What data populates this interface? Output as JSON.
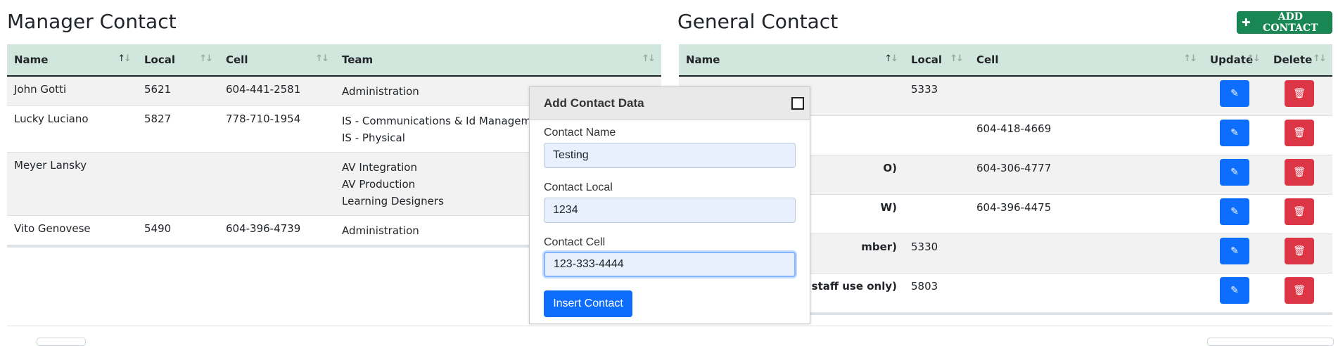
{
  "manager": {
    "title": "Manager Contact",
    "headers": {
      "name": "Name",
      "local": "Local",
      "cell": "Cell",
      "team": "Team"
    },
    "rows": [
      {
        "name": "John Gotti",
        "local": "5621",
        "cell": "604-441-2581",
        "team": [
          "Administration"
        ]
      },
      {
        "name": "Lucky Luciano",
        "local": "5827",
        "cell": "778-710-1954",
        "team": [
          "IS - Communications & Id Manageme",
          "IS - Physical"
        ]
      },
      {
        "name": "Meyer Lansky",
        "local": "",
        "cell": "",
        "team": [
          "AV Integration",
          "AV Production",
          "Learning Designers"
        ]
      },
      {
        "name": "Vito Genovese",
        "local": "5490",
        "cell": "604-396-4739",
        "team": [
          "Administration"
        ]
      }
    ]
  },
  "general": {
    "title": "General Contact",
    "add_button": "ADD CONTACT",
    "headers": {
      "name": "Name",
      "local": "Local",
      "cell": "Cell",
      "update": "Update",
      "delete": "Delete"
    },
    "rows": [
      {
        "name": "",
        "local": "5333",
        "cell": ""
      },
      {
        "name": "",
        "local": "",
        "cell": "604-418-4669"
      },
      {
        "name": "O)",
        "local": "",
        "cell": "604-306-4777"
      },
      {
        "name": "W)",
        "local": "",
        "cell": "604-396-4475"
      },
      {
        "name": "mber)",
        "local": "5330",
        "cell": ""
      },
      {
        "name": "S staff use only)",
        "local": "5803",
        "cell": ""
      }
    ]
  },
  "modal": {
    "title": "Add Contact Data",
    "name_label": "Contact Name",
    "name_value": "Testing",
    "local_label": "Contact Local",
    "local_value": "1234",
    "cell_label": "Contact Cell",
    "cell_value": "123-333-4444",
    "submit_label": "Insert Contact"
  },
  "colors": {
    "header_bg": "#d1e7dd",
    "add_button": "#198754",
    "edit_button": "#0d6efd",
    "delete_button": "#dc3545"
  },
  "icons": {
    "add": "plus-icon",
    "update": "edit-icon",
    "delete": "trash-icon",
    "sort": "sort-arrows-icon",
    "close": "checkbox-close-icon"
  }
}
